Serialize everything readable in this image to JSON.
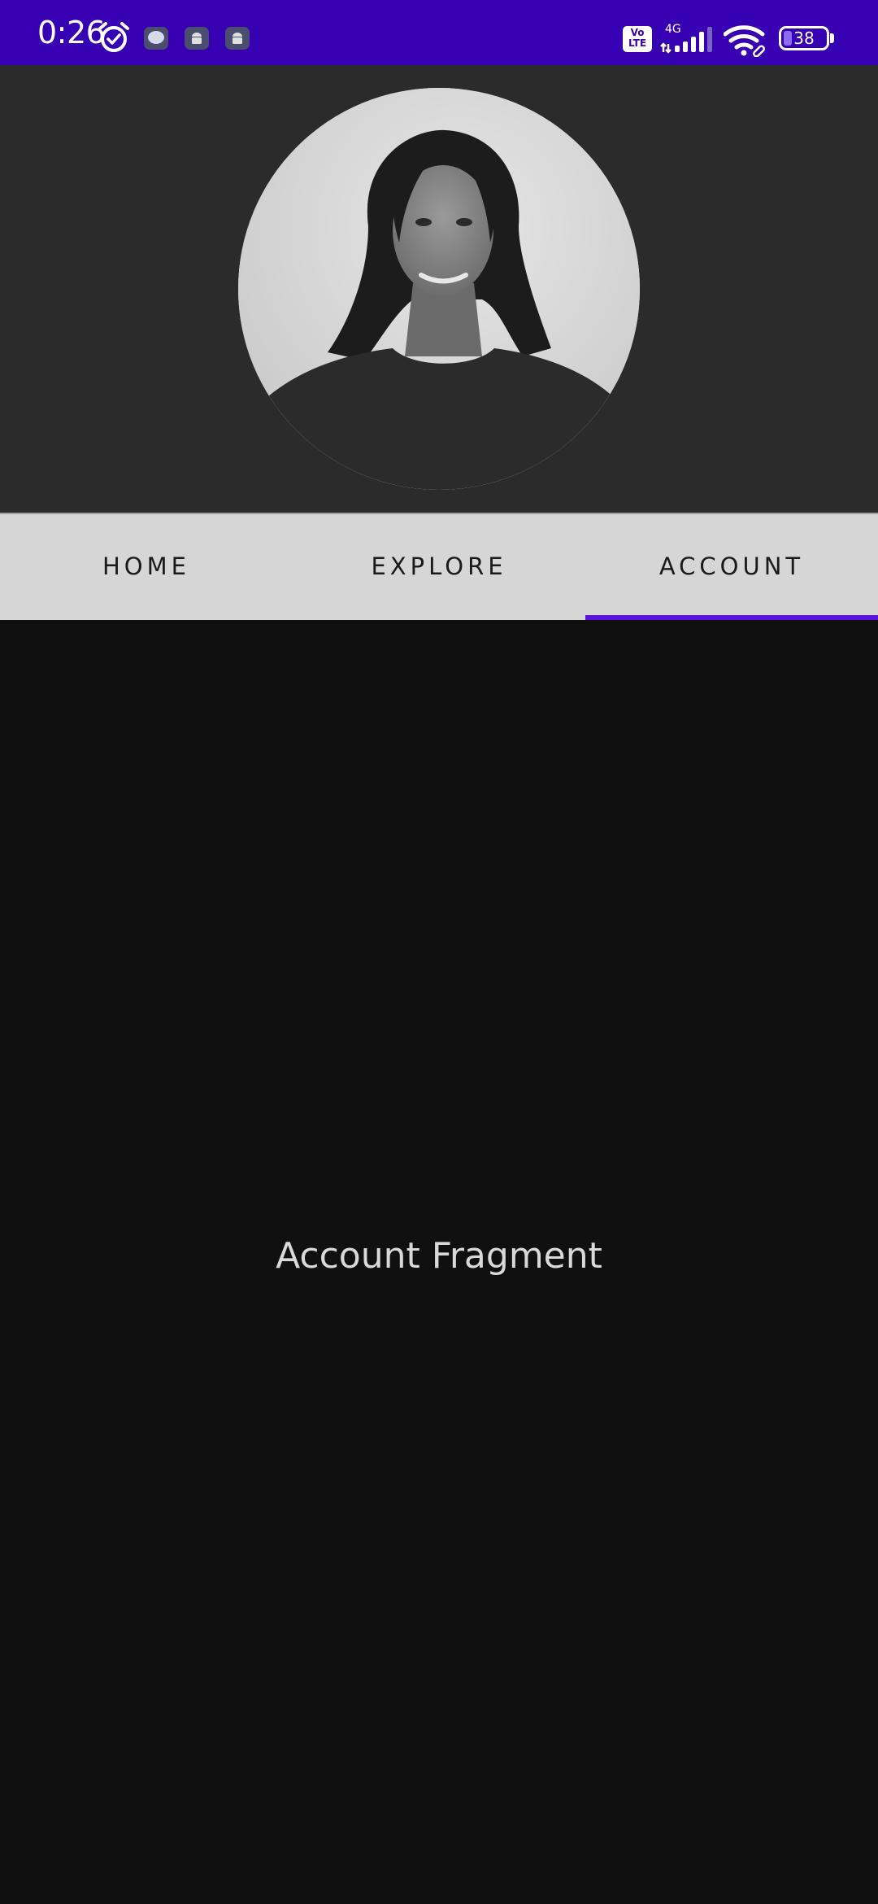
{
  "status_bar": {
    "time": "0:26",
    "network_label": "4G",
    "volte_label": "Vo\nLTE",
    "battery_level": "38",
    "icons": [
      "alarm-icon",
      "chat-bubble-icon",
      "android-icon",
      "android-icon",
      "volte-icon",
      "cell-signal-icon",
      "wifi-icon",
      "battery-icon"
    ],
    "background_color": "#3700b3"
  },
  "header": {
    "avatar": "profile-photo"
  },
  "tabs": [
    {
      "label": "HOME",
      "selected": false
    },
    {
      "label": "EXPLORE",
      "selected": false
    },
    {
      "label": "ACCOUNT",
      "selected": true
    }
  ],
  "tab_indicator_color": "#5b14e0",
  "content": {
    "label": "Account Fragment"
  }
}
